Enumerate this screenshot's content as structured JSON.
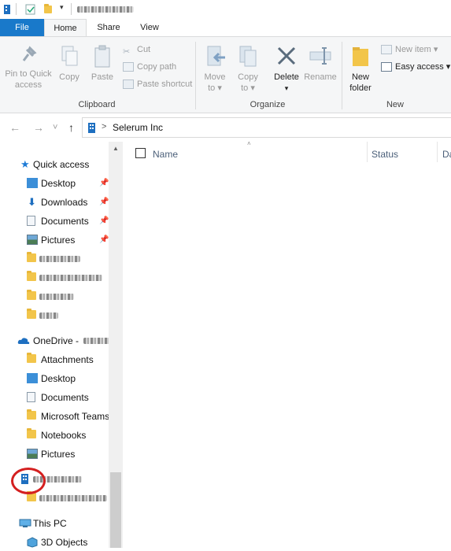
{
  "titlebar": {
    "icons": [
      "building-icon",
      "properties-icon",
      "new-folder-icon",
      "dropdown-arrow"
    ]
  },
  "ribbon_tabs": {
    "file": "File",
    "home": "Home",
    "share": "Share",
    "view": "View"
  },
  "clipboard": {
    "pin_line1": "Pin to Quick",
    "pin_line2": "access",
    "copy": "Copy",
    "paste": "Paste",
    "cut": "Cut",
    "copy_path": "Copy path",
    "paste_shortcut": "Paste shortcut",
    "group": "Clipboard"
  },
  "organize": {
    "move_line1": "Move",
    "move_line2": "to ▾",
    "copy_line1": "Copy",
    "copy_line2": "to ▾",
    "delete": "Delete",
    "delete_arrow": "▾",
    "rename": "Rename",
    "group": "Organize"
  },
  "new": {
    "folder_line1": "New",
    "folder_line2": "folder",
    "new_item": "New item ▾",
    "easy_access": "Easy access ▾",
    "group": "New"
  },
  "nav_buttons": {
    "back": "←",
    "forward": "→",
    "recent": "˅",
    "up": "↑"
  },
  "address": {
    "separator": ">",
    "location": "Selerum Inc"
  },
  "navpane": {
    "quick_access": "Quick access",
    "qa_items": [
      {
        "label": "Desktop",
        "pin": "📌"
      },
      {
        "label": "Downloads",
        "pin": "📌"
      },
      {
        "label": "Documents",
        "pin": "📌"
      },
      {
        "label": "Pictures",
        "pin": "📌"
      }
    ],
    "onedrive": "OneDrive -",
    "od_items": [
      "Attachments",
      "Desktop",
      "Documents",
      "Microsoft Teams",
      "Notebooks",
      "Pictures"
    ],
    "this_pc": "This PC",
    "pc_items": [
      "3D Objects"
    ],
    "scroll_up": "▲"
  },
  "columns": {
    "name": "Name",
    "status": "Status",
    "date": "Da",
    "sort_indicator": "˄"
  }
}
